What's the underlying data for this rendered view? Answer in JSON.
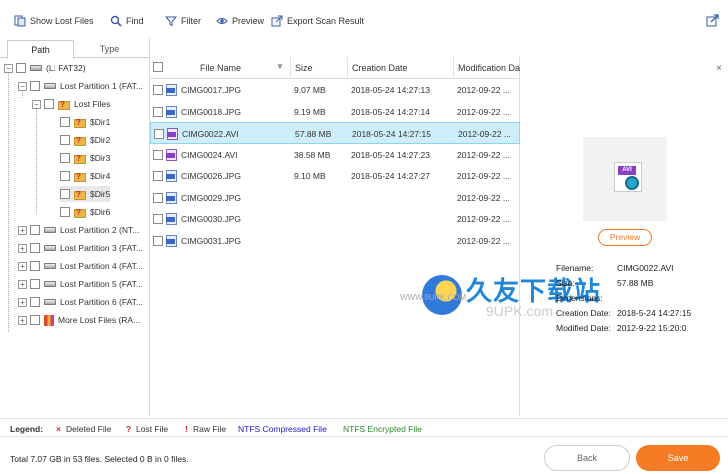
{
  "toolbar": {
    "show_lost_files": "Show Lost Files",
    "find": "Find",
    "filter": "Filter",
    "preview": "Preview",
    "export_scan_result": "Export Scan Result"
  },
  "tabs": {
    "path": "Path",
    "type": "Type"
  },
  "tree": {
    "root": "(L: FAT32)",
    "lost_partition_1": "Lost Partition 1 (FAT...",
    "lost_files": "Lost Files",
    "dirs": [
      "$Dir1",
      "$Dir2",
      "$Dir3",
      "$Dir4",
      "$Dir5",
      "$Dir6"
    ],
    "partitions": [
      "Lost Partition 2 (NT...",
      "Lost Partition 3 (FAT...",
      "Lost Partition 4 (FAT...",
      "Lost Partition 5 (FAT...",
      "Lost Partition 6 (FAT..."
    ],
    "more_lost_files": "More Lost Files (RA..."
  },
  "file_list": {
    "columns": {
      "name": "File Name",
      "size": "Size",
      "created": "Creation Date",
      "modified": "Modification Da"
    },
    "rows": [
      {
        "name": "CIMG0017.JPG",
        "size": "9.07 MB",
        "created": "2018-05-24 14:27:13",
        "modified": "2012-09-22 ...",
        "type": "jpg"
      },
      {
        "name": "CIMG0018.JPG",
        "size": "9.19 MB",
        "created": "2018-05-24 14:27:14",
        "modified": "2012-09-22 ...",
        "type": "jpg"
      },
      {
        "name": "CIMG0022.AVI",
        "size": "57.88 MB",
        "created": "2018-05-24 14:27:15",
        "modified": "2012-09-22 ...",
        "type": "avi",
        "selected": true
      },
      {
        "name": "CIMG0024.AVI",
        "size": "38.58 MB",
        "created": "2018-05-24 14:27:23",
        "modified": "2012-09-22 ...",
        "type": "avi"
      },
      {
        "name": "CIMG0026.JPG",
        "size": "9.10 MB",
        "created": "2018-05-24 14:27:27",
        "modified": "2012-09-22 ...",
        "type": "jpg"
      },
      {
        "name": "CIMG0029.JPG",
        "size": "",
        "created": "",
        "modified": "2012-09-22 ...",
        "type": "jpg"
      },
      {
        "name": "CIMG0030.JPG",
        "size": "",
        "created": "",
        "modified": "2012-09-22 ...",
        "type": "jpg"
      },
      {
        "name": "CIMG0031.JPG",
        "size": "",
        "created": "",
        "modified": "2012-09-22 ...",
        "type": "jpg"
      }
    ]
  },
  "preview": {
    "button": "Preview",
    "file_tag": "AVI",
    "filename_label": "Filename:",
    "filename": "CIMG0022.AVI",
    "size_label": "Size:",
    "size": "57.88 MB",
    "dimensions_label": "Dimensions:",
    "dimensions": "",
    "created_label": "Creation Date:",
    "created": "2018-5-24 14:27:15",
    "modified_label": "Modified Date:",
    "modified": "2012-9-22 15:20:0"
  },
  "legend": {
    "label": "Legend:",
    "deleted": "Deleted File",
    "lost": "Lost File",
    "raw": "Raw File",
    "ntfs_compressed": "NTFS Compressed File",
    "ntfs_encrypted": "NTFS Encrypted File",
    "deleted_mark": "×",
    "lost_mark": "?",
    "raw_mark": "!"
  },
  "footer": {
    "total": "Total 7.07 GB in 53 files.  Selected 0 B in 0 files.",
    "back": "Back",
    "save": "Save"
  },
  "watermark": {
    "title": "久友下载站",
    "url": "9UPK.com",
    "small": "WWW.9UPK.COM"
  },
  "colors": {
    "accent": "#f57c25",
    "selected_row": "#cdeefa",
    "ntfs_compressed": "#2222cc",
    "ntfs_encrypted": "#2a8a2a",
    "deleted": "#d22222"
  }
}
